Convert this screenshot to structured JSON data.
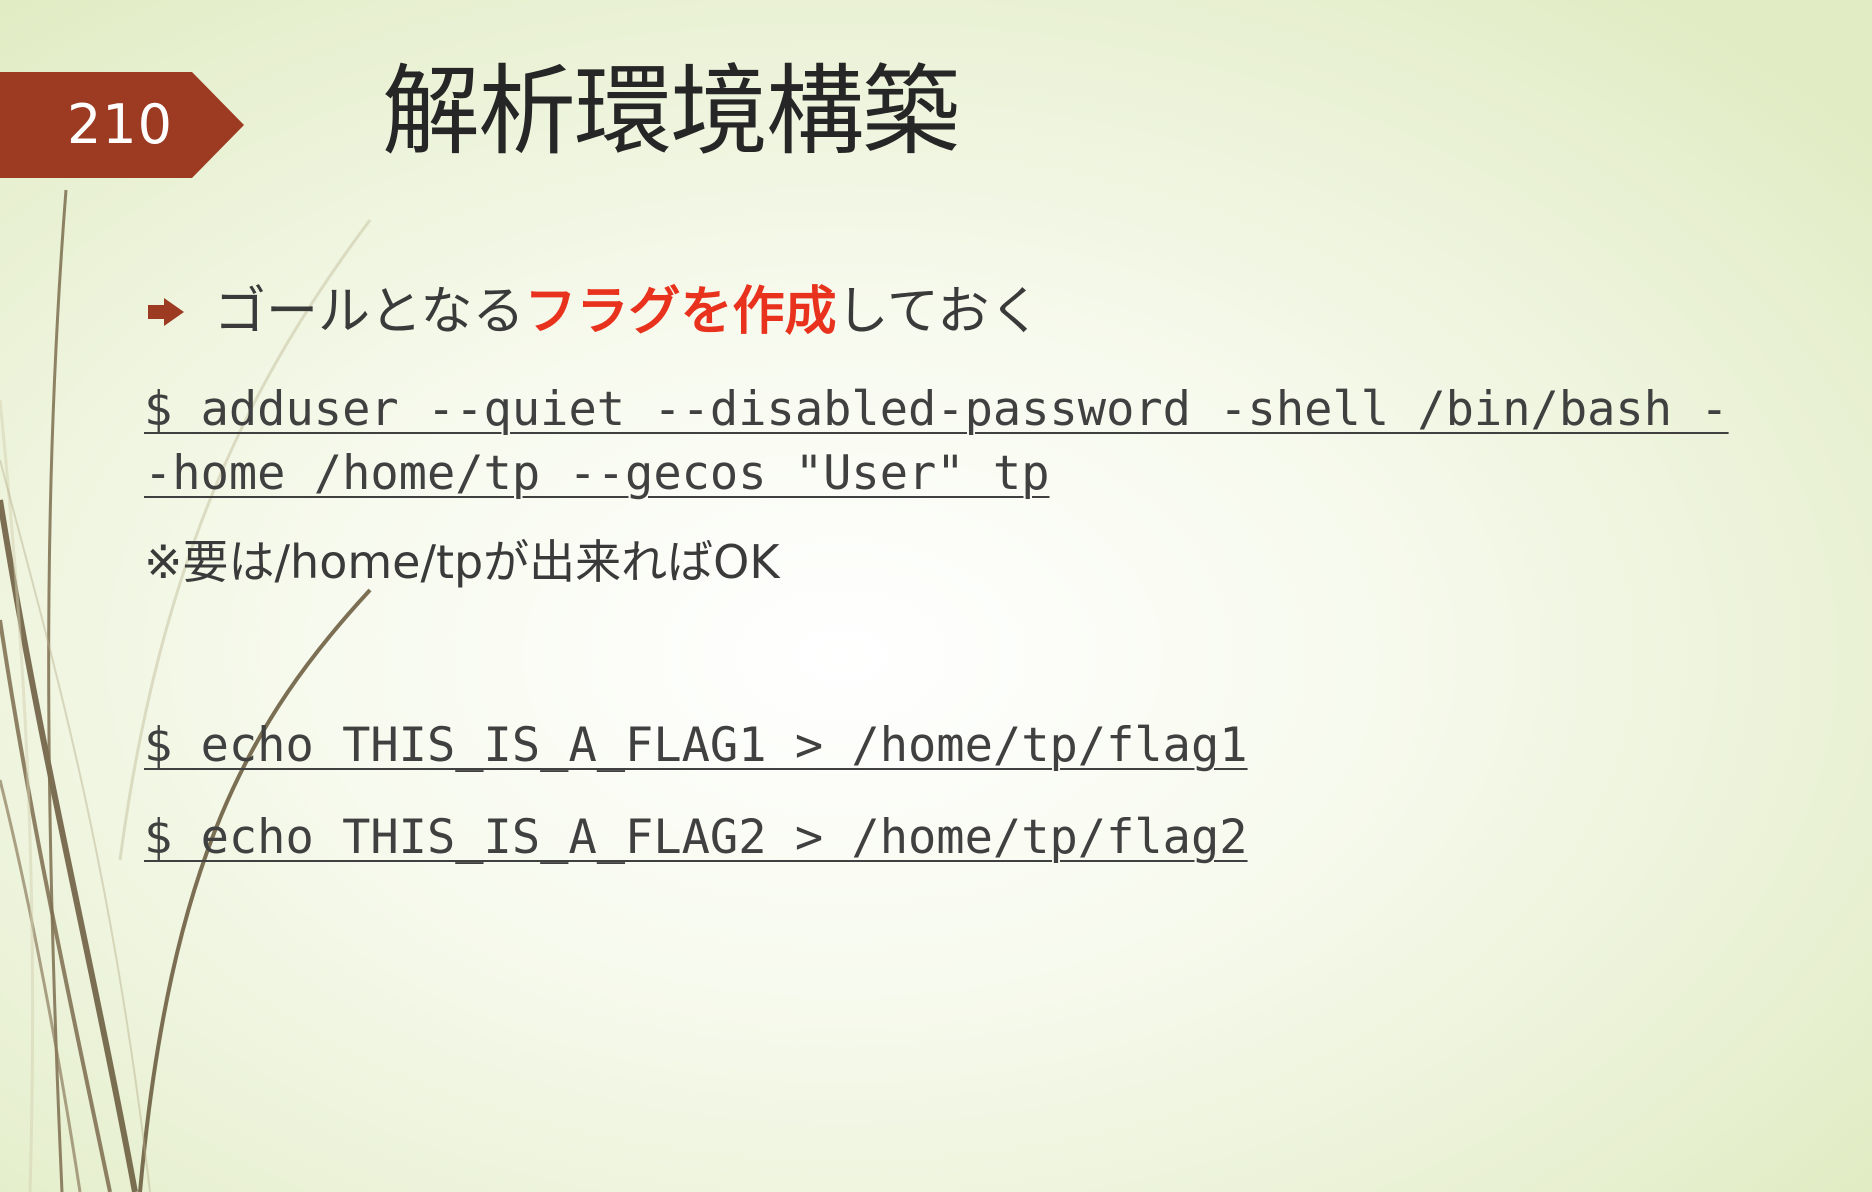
{
  "slide": {
    "page_number": "210",
    "title": "解析環境構築",
    "bullet": {
      "text_before": "ゴールとなる",
      "text_emphasis": "フラグを作成",
      "text_after": "しておく"
    },
    "commands": {
      "adduser_line1": "$ adduser --quiet --disabled-password -shell /bin/bash -",
      "adduser_line2": "-home /home/tp --gecos \"User\" tp",
      "flag1": "$ echo THIS_IS_A_FLAG1 > /home/tp/flag1",
      "flag2": "$ echo THIS_IS_A_FLAG2 > /home/tp/flag2"
    },
    "note": "※要は/home/tpが出来ればOK"
  },
  "colors": {
    "page_tag": "#9c3a22",
    "emphasis": "#e8321e",
    "title_text": "#262626",
    "body_text": "#3a3a3a",
    "decoration_lines": "#7a6a48"
  },
  "icons": {
    "bullet": "arrow-bullet-icon"
  }
}
